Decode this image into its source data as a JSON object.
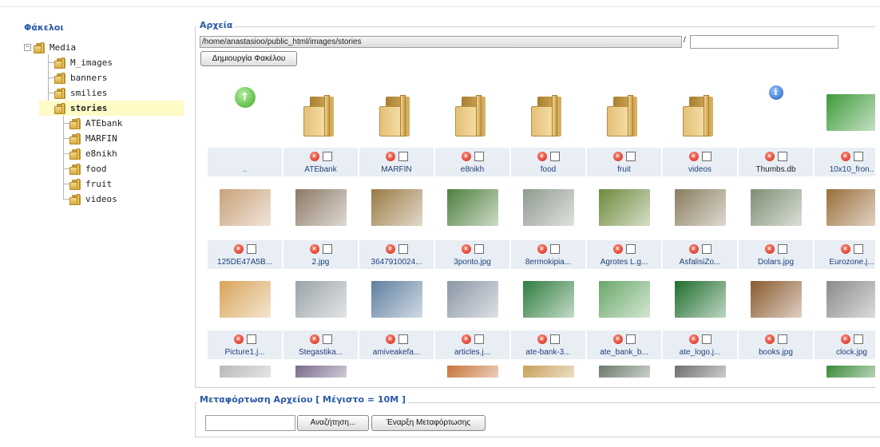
{
  "tree": {
    "title": "Φάκελοι",
    "root": "Media",
    "items": [
      {
        "label": "M_images"
      },
      {
        "label": "banners"
      },
      {
        "label": "smilies"
      },
      {
        "label": "stories",
        "selected": true
      },
      {
        "label": "ATEbank"
      },
      {
        "label": "MARFIN"
      },
      {
        "label": "e8nikh"
      },
      {
        "label": "food"
      },
      {
        "label": "fruit"
      },
      {
        "label": "videos"
      }
    ]
  },
  "files": {
    "legend": "Αρχεία",
    "path": "/home/anastasioo/public_html/images/stories",
    "separator": "/",
    "folder_name": "",
    "create_button": "Δημιουργία Φακέλου"
  },
  "grid": {
    "rows": [
      [
        {
          "kind": "up",
          "name": ".."
        },
        {
          "kind": "folder",
          "name": "ATEbank"
        },
        {
          "kind": "folder",
          "name": "MARFIN"
        },
        {
          "kind": "folder",
          "name": "e8nikh"
        },
        {
          "kind": "folder",
          "name": "food"
        },
        {
          "kind": "folder",
          "name": "fruit"
        },
        {
          "kind": "folder",
          "name": "videos"
        },
        {
          "kind": "info",
          "name": "Thumbs.db"
        },
        {
          "kind": "img",
          "name": "10x10_fron..",
          "color": "#3e9a3a"
        }
      ],
      [
        {
          "kind": "img",
          "name": "125DE47A5B...",
          "color": "#c9a27a"
        },
        {
          "kind": "img",
          "name": "2.jpg",
          "color": "#8c7a66"
        },
        {
          "kind": "img",
          "name": "3647910024...",
          "color": "#9a7a45"
        },
        {
          "kind": "img",
          "name": "3ponto.jpg",
          "color": "#4f7f3e"
        },
        {
          "kind": "img",
          "name": "8ermokipia...",
          "color": "#8f9a8e"
        },
        {
          "kind": "img",
          "name": "Agrotes L.g...",
          "color": "#6d8a3c"
        },
        {
          "kind": "img",
          "name": "AsfalisiZo...",
          "color": "#8a7d5e"
        },
        {
          "kind": "img",
          "name": "Dolars.jpg",
          "color": "#7e8f73"
        },
        {
          "kind": "img",
          "name": "Eurozone.j...",
          "color": "#9a6e3a"
        }
      ],
      [
        {
          "kind": "img",
          "name": "Picture1.j...",
          "color": "#d9a45a"
        },
        {
          "kind": "img",
          "name": "Stegastika...",
          "color": "#9aa3a8"
        },
        {
          "kind": "img",
          "name": "amiveakefa...",
          "color": "#5f7fa0"
        },
        {
          "kind": "img",
          "name": "articles.j...",
          "color": "#8a96a5"
        },
        {
          "kind": "img",
          "name": "ate-bank-3...",
          "color": "#2f7d3f"
        },
        {
          "kind": "img",
          "name": "ate_bank_b...",
          "color": "#6aa86a"
        },
        {
          "kind": "img",
          "name": "ate_logo.j...",
          "color": "#1f6e2e"
        },
        {
          "kind": "img",
          "name": "books.jpg",
          "color": "#8a5a2e"
        },
        {
          "kind": "img",
          "name": "clock.jpg",
          "color": "#8a8a8a"
        }
      ],
      [
        {
          "kind": "img",
          "name": "",
          "color": "#b8b8b8"
        },
        {
          "kind": "img",
          "name": "",
          "color": "#7a6a8a"
        },
        {
          "kind": "img",
          "name": "",
          "color": "#ffffff"
        },
        {
          "kind": "img",
          "name": "",
          "color": "#c8743a"
        },
        {
          "kind": "img",
          "name": "",
          "color": "#c8a05a"
        },
        {
          "kind": "img",
          "name": "",
          "color": "#6a7a6a"
        },
        {
          "kind": "img",
          "name": "",
          "color": "#6e6e6e"
        },
        {
          "kind": "img",
          "name": "",
          "color": "#ffffff"
        },
        {
          "kind": "img",
          "name": "",
          "color": "#3a8a3a"
        }
      ]
    ]
  },
  "upload": {
    "legend": "Μεταφόρτωση Αρχείου [ Μέγιστο = 10M ]",
    "browse_button": "Αναζήτηση...",
    "start_button": "Έναρξη Μεταφόρτωσης"
  }
}
